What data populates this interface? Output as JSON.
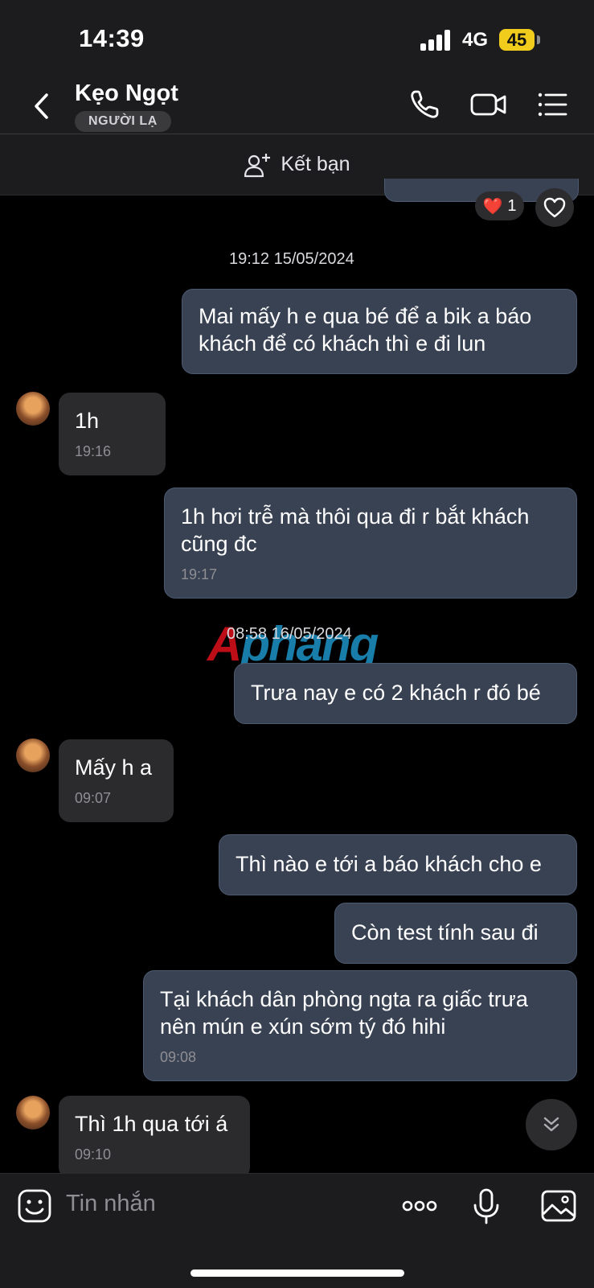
{
  "status_bar": {
    "time": "14:39",
    "network": "4G",
    "battery": "45"
  },
  "header": {
    "title": "Kẹo Ngọt",
    "tag": "NGƯỜI LẠ"
  },
  "add_friend": {
    "label": "Kết bạn"
  },
  "reaction": {
    "emoji": "❤️",
    "count": "1"
  },
  "watermark": {
    "part1": "A",
    "part2": "phang"
  },
  "messages": [
    {
      "type": "timestamp",
      "text": "19:12 15/05/2024"
    },
    {
      "type": "outgoing",
      "text": "Mai mấy h e qua bé để a bik a báo khách để có khách thì e đi lun"
    },
    {
      "type": "incoming",
      "text": "1h",
      "time": "19:16"
    },
    {
      "type": "outgoing",
      "text": "1h hơi trễ mà thôi qua đi r bắt khách cũng đc",
      "time": "19:17"
    },
    {
      "type": "timestamp",
      "text": "08:58 16/05/2024"
    },
    {
      "type": "outgoing",
      "text": "Trưa nay e có 2 khách r đó bé"
    },
    {
      "type": "incoming",
      "text": "Mấy h a",
      "time": "09:07"
    },
    {
      "type": "outgoing",
      "text": "Thì nào e tới a báo khách cho e"
    },
    {
      "type": "outgoing",
      "text": "Còn test tính sau đi"
    },
    {
      "type": "outgoing",
      "text": "Tại khách dân phòng ngta ra giấc trưa nên mún e xún sớm tý đó hihi",
      "time": "09:08"
    },
    {
      "type": "incoming",
      "text": "Thì 1h qua tới á",
      "time": "09:10"
    }
  ],
  "composer": {
    "placeholder": "Tin nhắn"
  },
  "colors": {
    "outgoing_bubble": "#394253",
    "incoming_bubble": "#2b2b2d",
    "battery": "#f2cc1d"
  }
}
